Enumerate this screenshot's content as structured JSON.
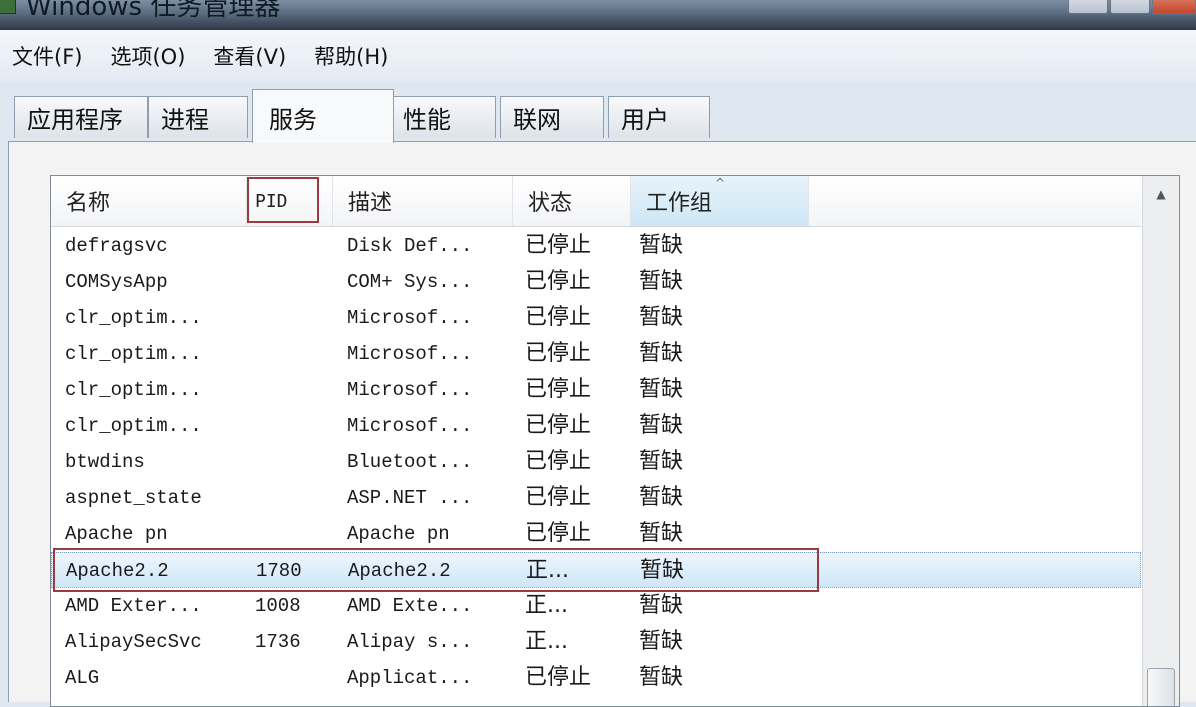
{
  "window": {
    "title": "Windows 任务管理器"
  },
  "menu": [
    "文件(F)",
    "选项(O)",
    "查看(V)",
    "帮助(H)"
  ],
  "tabs": [
    "应用程序",
    "进程",
    "服务",
    "性能",
    "联网",
    "用户"
  ],
  "active_tab": "服务",
  "columns": {
    "name": "名称",
    "pid": "PID",
    "description": "描述",
    "status": "状态",
    "group": "工作组"
  },
  "sorted_column": "工作组",
  "services": [
    {
      "name": "defragsvc",
      "pid": "",
      "description": "Disk Def...",
      "status": "已停止",
      "group": "暂缺"
    },
    {
      "name": "COMSysApp",
      "pid": "",
      "description": "COM+ Sys...",
      "status": "已停止",
      "group": "暂缺"
    },
    {
      "name": "clr_optim...",
      "pid": "",
      "description": "Microsof...",
      "status": "已停止",
      "group": "暂缺"
    },
    {
      "name": "clr_optim...",
      "pid": "",
      "description": "Microsof...",
      "status": "已停止",
      "group": "暂缺"
    },
    {
      "name": "clr_optim...",
      "pid": "",
      "description": "Microsof...",
      "status": "已停止",
      "group": "暂缺"
    },
    {
      "name": "clr_optim...",
      "pid": "",
      "description": "Microsof...",
      "status": "已停止",
      "group": "暂缺"
    },
    {
      "name": "btwdins",
      "pid": "",
      "description": "Bluetoot...",
      "status": "已停止",
      "group": "暂缺"
    },
    {
      "name": "aspnet_state",
      "pid": "",
      "description": "ASP.NET ...",
      "status": "已停止",
      "group": "暂缺"
    },
    {
      "name": "Apache pn",
      "pid": "",
      "description": "Apache pn",
      "status": "已停止",
      "group": "暂缺"
    },
    {
      "name": "Apache2.2",
      "pid": "1780",
      "description": "Apache2.2",
      "status": "正...",
      "group": "暂缺"
    },
    {
      "name": "AMD Exter...",
      "pid": "1008",
      "description": "AMD Exte...",
      "status": "正...",
      "group": "暂缺"
    },
    {
      "name": "AlipaySecSvc",
      "pid": "1736",
      "description": "Alipay s...",
      "status": "正...",
      "group": "暂缺"
    },
    {
      "name": "ALG",
      "pid": "",
      "description": "Applicat...",
      "status": "已停止",
      "group": "暂缺"
    }
  ],
  "selected_service": "Apache2.2",
  "colors": {
    "highlight_border": "#9c3b3f",
    "selection": "#cfe6f8"
  }
}
